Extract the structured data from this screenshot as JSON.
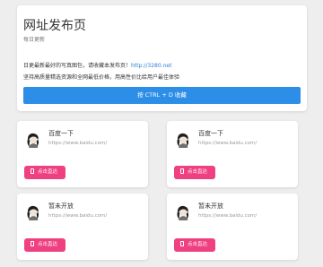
{
  "colors": {
    "background": "#eeeeee",
    "card": "#ffffff",
    "accent_blue": "#2d8ee8",
    "accent_pink": "#ef4181",
    "link": "#2f80d3",
    "muted_text": "#999999"
  },
  "header": {
    "title": "网址发布页",
    "subtitle": "每日更新",
    "notice_text": "日更最新最好的写真图包，请收藏本发布页！",
    "notice_link": "http://3280.net",
    "notice_line2": "坚持高质量精选资源和全网最低价格，用高性价比给用户最佳体验",
    "bookmark_label": "按 CTRL + D 收藏"
  },
  "cards": [
    {
      "name": "百度一下",
      "url": "https://www.baidu.com/",
      "button_label": "点击直达"
    },
    {
      "name": "百度一下",
      "url": "https://www.baidu.com/",
      "button_label": "点击直达"
    },
    {
      "name": "暂未开放",
      "url": "https://www.baidu.com/",
      "button_label": "点击直达"
    },
    {
      "name": "暂未开放",
      "url": "https://www.baidu.com/",
      "button_label": "点击直达"
    }
  ]
}
